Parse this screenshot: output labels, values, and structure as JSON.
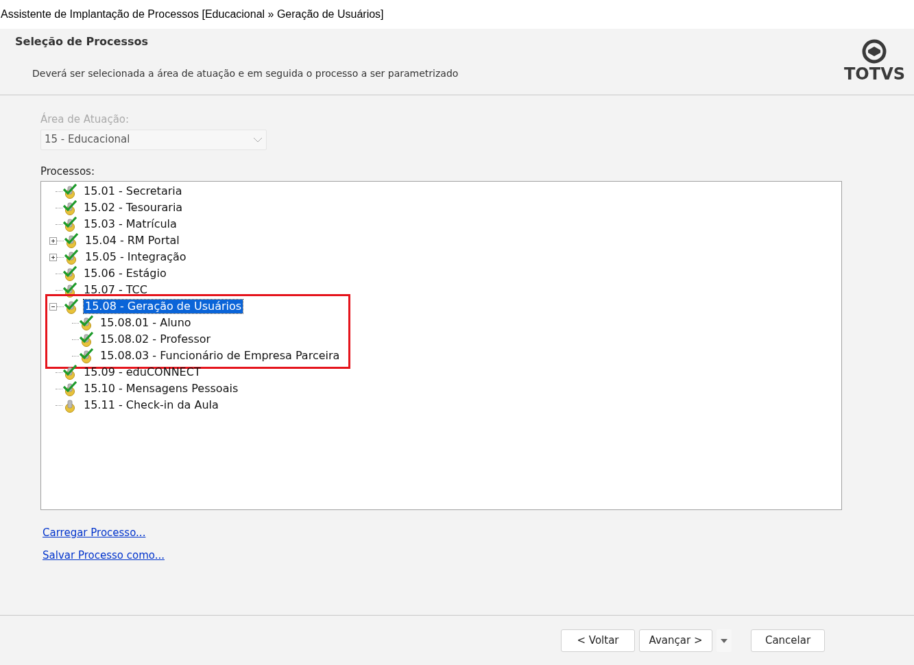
{
  "window": {
    "title": "Assistente de Implantação de Processos [Educacional » Geração de Usuários]"
  },
  "header": {
    "title": "Seleção de Processos",
    "description": "Deverá ser selecionada a área de atuação e em seguida o processo a ser parametrizado",
    "logo_text": "TOTVS"
  },
  "area": {
    "label": "Área de Atuação:",
    "value": "15 - Educacional",
    "disabled": true
  },
  "processes": {
    "label": "Processos:",
    "items": [
      {
        "label": "15.01 - Secretaria",
        "checked": true,
        "selected": false,
        "highlighted": false
      },
      {
        "label": "15.02 - Tesouraria",
        "checked": true,
        "selected": false,
        "highlighted": false
      },
      {
        "label": "15.03 - Matrícula",
        "checked": true,
        "selected": false,
        "highlighted": false
      },
      {
        "label": "15.04 - RM Portal",
        "checked": true,
        "selected": false,
        "highlighted": false,
        "expanded": false
      },
      {
        "label": "15.05 - Integração",
        "checked": true,
        "selected": false,
        "highlighted": false,
        "expanded": false
      },
      {
        "label": "15.06 - Estágio",
        "checked": true,
        "selected": false,
        "highlighted": false
      },
      {
        "label": "15.07 - TCC",
        "checked": true,
        "selected": false,
        "highlighted": false
      },
      {
        "label": "15.08 - Geração de Usuários",
        "checked": true,
        "selected": true,
        "highlighted": true,
        "expanded": true,
        "children": [
          {
            "label": "15.08.01 - Aluno",
            "checked": true,
            "selected": false
          },
          {
            "label": "15.08.02 - Professor",
            "checked": true,
            "selected": false
          },
          {
            "label": "15.08.03 - Funcionário de Empresa Parceira",
            "checked": true,
            "selected": false
          }
        ]
      },
      {
        "label": "15.09 - eduCONNECT",
        "checked": true,
        "selected": false,
        "highlighted": false
      },
      {
        "label": "15.10 - Mensagens Pessoais",
        "checked": true,
        "selected": false,
        "highlighted": false
      },
      {
        "label": "15.11 - Check-in da Aula",
        "checked": false,
        "selected": false,
        "highlighted": false
      }
    ]
  },
  "links": [
    "Carregar Processo...",
    "Salvar Processo como..."
  ],
  "buttons": {
    "back": "< Voltar",
    "next": "Avançar >",
    "cancel": "Cancelar"
  }
}
